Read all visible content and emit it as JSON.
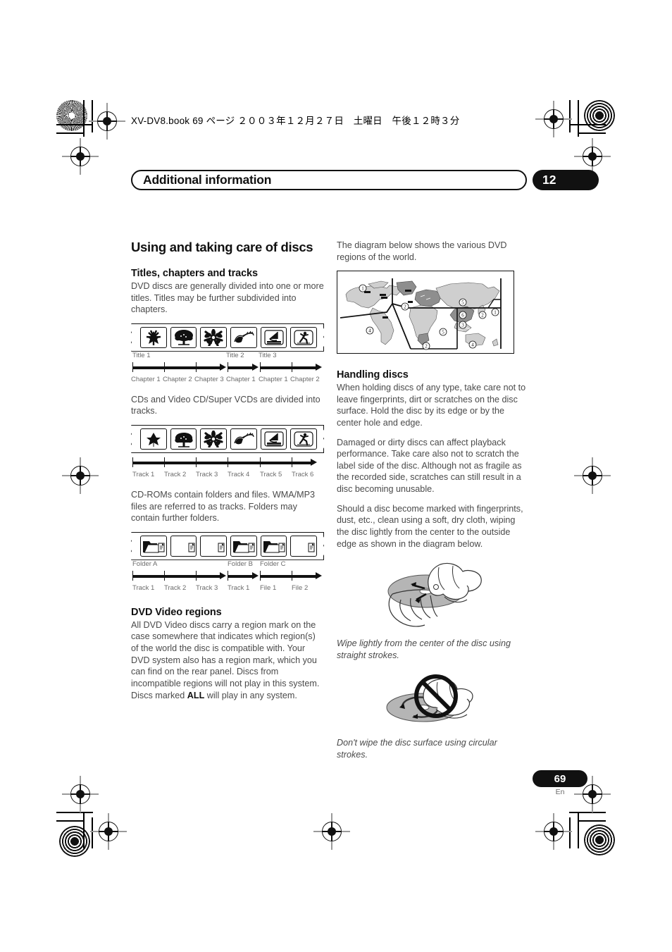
{
  "print_slug": "XV-DV8.book  69 ページ  ２００３年１２月２７日　土曜日　午後１２時３分",
  "running_head": {
    "title": "Additional information",
    "chapter_number": "12"
  },
  "left_column": {
    "section_title": "Using and taking care of discs",
    "titles_chapters": {
      "heading": "Titles, chapters and tracks",
      "paragraph": "DVD discs are generally divided into one or more titles. Titles may be further subdivided into chapters."
    },
    "figure_titles": {
      "name": "titles-and-chapters-diagram",
      "frames": [
        "leaf-icon",
        "tree-icon",
        "flower-icon",
        "bird-hand-icon",
        "windsurf-icon",
        "runner-icon"
      ],
      "title_labels": [
        "Title 1",
        "Title 2",
        "Title 3"
      ],
      "chapter_labels": [
        "Chapter 1",
        "Chapter 2",
        "Chapter 3",
        "Chapter 1",
        "Chapter 1",
        "Chapter 2"
      ]
    },
    "tracks_paragraph": "CDs and Video CD/Super VCDs are divided into tracks.",
    "figure_tracks": {
      "name": "tracks-diagram",
      "frames": [
        "leaf-icon",
        "tree-icon",
        "flower-icon",
        "bird-hand-icon",
        "windsurf-icon",
        "runner-icon"
      ],
      "track_labels": [
        "Track 1",
        "Track 2",
        "Track 3",
        "Track 4",
        "Track 5",
        "Track 6"
      ]
    },
    "folders_paragraph": "CD-ROMs contain folders and files. WMA/MP3 files are referred to as tracks. Folders may contain further folders.",
    "figure_folders": {
      "name": "folders-and-files-diagram",
      "frames": [
        "folder-file-icon",
        "file-icon",
        "file-icon",
        "folder-file-icon",
        "folder-file-icon",
        "file-icon"
      ],
      "folder_labels": [
        "Folder A",
        "Folder B",
        "Folder C"
      ],
      "item_labels": [
        "Track 1",
        "Track 2",
        "Track 3",
        "Track 1",
        "File 1",
        "File 2"
      ]
    },
    "dvd_regions": {
      "heading": "DVD Video regions",
      "paragraph_part1": "All DVD Video discs carry a region mark on the case somewhere that indicates which region(s) of the world the disc is compatible with. Your DVD system also has a region mark, which you can find on the rear panel. Discs from incompatible regions will not play in this system. Discs marked ",
      "paragraph_bold": "ALL",
      "paragraph_part2": " will play in any system."
    }
  },
  "right_column": {
    "map_intro": "The diagram below shows the various DVD regions of the world.",
    "world_map": {
      "name": "dvd-region-world-map",
      "region_markers": [
        "1",
        "2",
        "4",
        "2",
        "5",
        "3",
        "5",
        "6",
        "2",
        "1",
        "4"
      ]
    },
    "handling_discs": {
      "heading": "Handling discs",
      "paragraph1": "When holding discs of any type, take care not to leave fingerprints, dirt or scratches on the disc surface. Hold the disc by its edge or by the center hole and edge.",
      "paragraph2": "Damaged or dirty discs can affect playback performance. Take care also not to scratch the label side of the disc. Although not as fragile as the recorded side, scratches can still result in a disc becoming unusable.",
      "paragraph3": "Should a disc become marked with fingerprints, dust, etc., clean using a soft, dry cloth, wiping the disc lightly from the center to the outside edge as shown in the diagram below."
    },
    "illustration_do": {
      "name": "wipe-straight-illustration",
      "caption": "Wipe lightly from the center of the disc using straight strokes."
    },
    "illustration_dont": {
      "name": "wipe-circular-prohibited-illustration",
      "caption": "Don't wipe the disc surface using circular strokes."
    }
  },
  "footer": {
    "page_number": "69",
    "language": "En"
  },
  "colors": {
    "ink": "#111111",
    "body_text": "#4a4a4a",
    "label_text": "#6b6b6b",
    "map_land": "#cfcfcf",
    "map_dark": "#8e8e8e"
  }
}
